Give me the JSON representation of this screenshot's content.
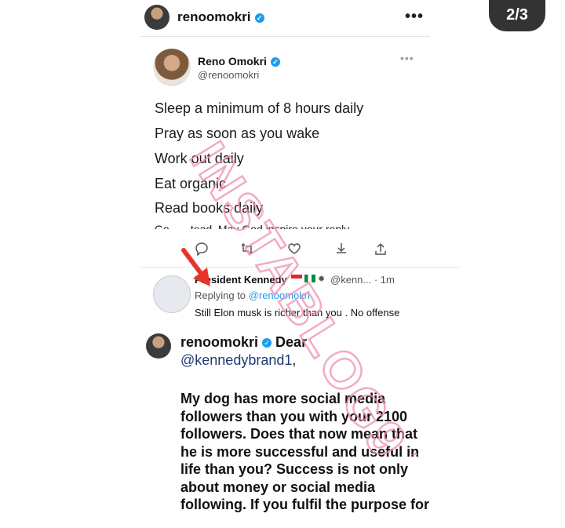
{
  "header": {
    "username": "renoomokri",
    "more": "•••",
    "counter": "2/3"
  },
  "tweet": {
    "name": "Reno Omokri",
    "handle": "@renoomokri",
    "more": "•••",
    "lines": [
      "Sleep a minimum of 8 hours daily",
      "Pray as soon as you wake",
      "Work out daily",
      "Eat organic",
      "Read books daily"
    ],
    "cut_line": "Go... ...tead. May God inspire your reply."
  },
  "reply": {
    "name": "President Kennedy",
    "meta": "@kenn... · 1m",
    "replying_prefix": "Replying to",
    "replying_to": "@renoomokri",
    "text": "Still Elon musk is richer than you . No offense"
  },
  "caption": {
    "username": "renoomokri",
    "greeting": "Dear",
    "mention": "@kennedybrand1",
    "lines": [
      "My dog has more social media",
      "followers than you with your 2100",
      "followers. Does that now mean that",
      "he is more successful and useful in",
      "life than you? Success is not only",
      "about money or social media",
      "following. If you fulfil the purpose for"
    ]
  },
  "watermark": {
    "text": "INSTABLOG9JA",
    "color": "#f08fb0"
  },
  "colors": {
    "verified": "#1d9bf0",
    "arrow": "#e8332a"
  },
  "icons": [
    "verified-badge-icon",
    "more-icon",
    "reply-icon",
    "retweet-icon",
    "like-icon",
    "share-icon",
    "upload-icon"
  ]
}
